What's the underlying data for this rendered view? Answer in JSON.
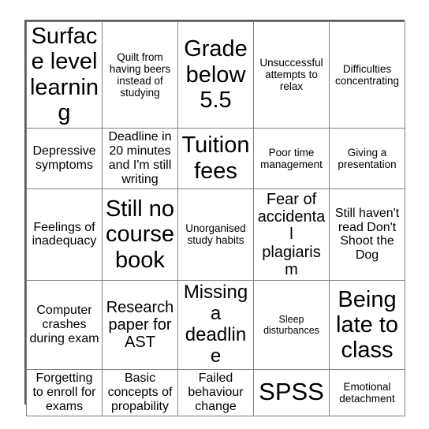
{
  "card": {
    "type": "bingo-card",
    "rows": 5,
    "columns": 5,
    "border_color": "#595959",
    "grid_line_color": "#808080",
    "background_color": "#ffffff",
    "text_color": "#000000",
    "cells": [
      [
        {
          "text": "Surface level learning",
          "size": "xxl"
        },
        {
          "text": "Quilt from having beers instead of studying",
          "size": "s"
        },
        {
          "text": "Grade below 5.5",
          "size": "xxl"
        },
        {
          "text": "Unsuccessful attempts to relax",
          "size": "s"
        },
        {
          "text": "Difficulties concentrating",
          "size": "s"
        }
      ],
      [
        {
          "text": "Depressive symptoms",
          "size": "m"
        },
        {
          "text": "Deadline in 20 minutes and I'm still writing",
          "size": "m"
        },
        {
          "text": "Tuition fees",
          "size": "xxl"
        },
        {
          "text": "Poor time management",
          "size": "s"
        },
        {
          "text": "Giving a presentation",
          "size": "s"
        }
      ],
      [
        {
          "text": "Feelings of inadequacy",
          "size": "m"
        },
        {
          "text": "Still no course book",
          "size": "xxl"
        },
        {
          "text": "Unorganised study habits",
          "size": "s"
        },
        {
          "text": "Fear of accidental plagiarism",
          "size": "l"
        },
        {
          "text": "Still haven't read Don't Shoot the Dog",
          "size": "m"
        }
      ],
      [
        {
          "text": "Computer crashes during exam",
          "size": "m"
        },
        {
          "text": "Research paper for AST",
          "size": "l"
        },
        {
          "text": "Missing a deadline",
          "size": "xl"
        },
        {
          "text": "Sleep disturbances",
          "size": "xs"
        },
        {
          "text": "Being late to class",
          "size": "xxl"
        }
      ],
      [
        {
          "text": "Forgetting to enroll for exams",
          "size": "m"
        },
        {
          "text": "Basic concepts of propability",
          "size": "m"
        },
        {
          "text": "Failed behaviour change",
          "size": "m"
        },
        {
          "text": "SPSS",
          "size": "huge"
        },
        {
          "text": "Emotional detachment",
          "size": "s"
        }
      ]
    ]
  }
}
